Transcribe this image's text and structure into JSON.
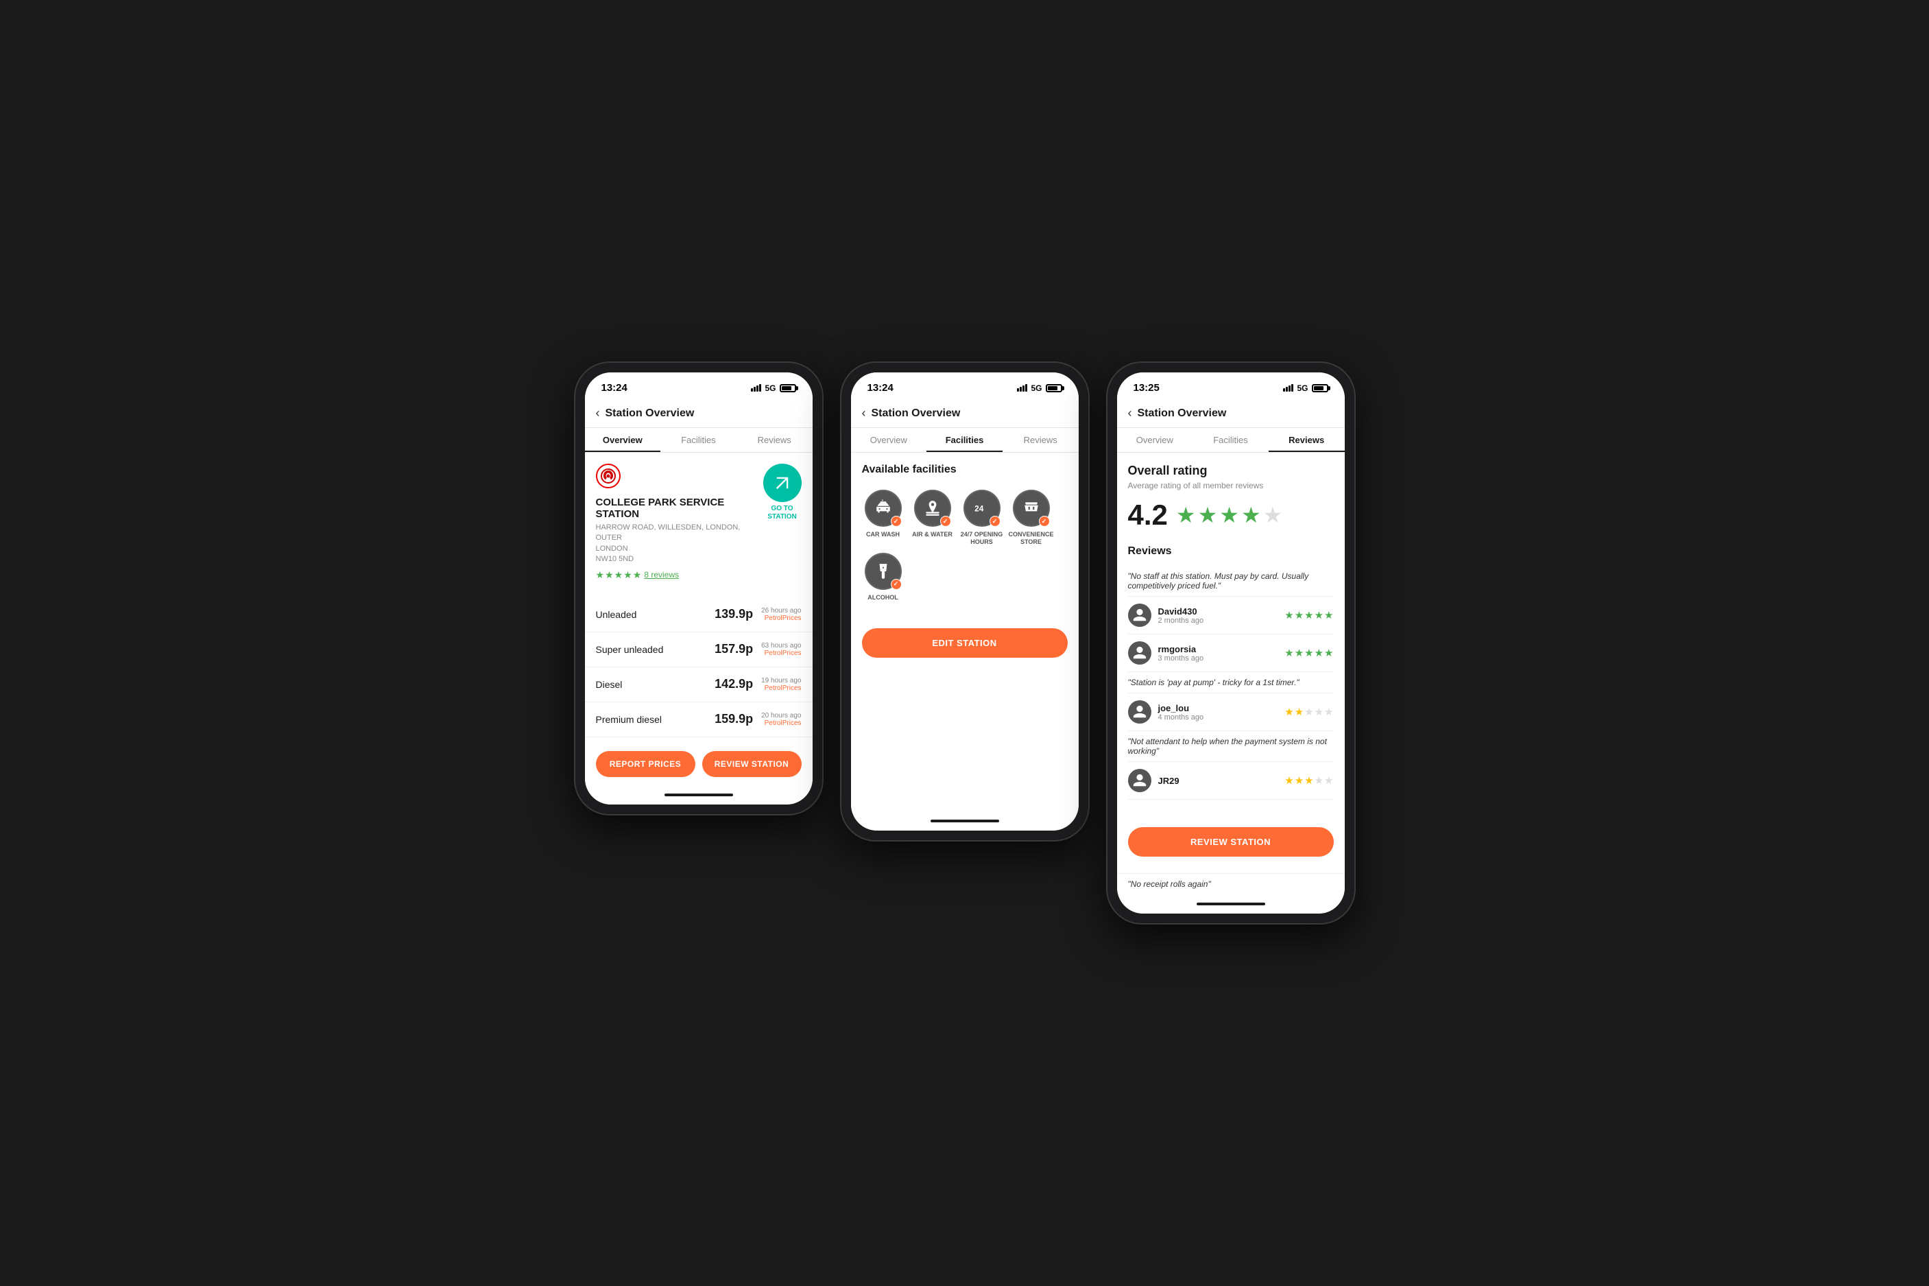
{
  "phones": [
    {
      "id": "phone1",
      "status_time": "13:24",
      "network": "5G",
      "nav_title": "Station Overview",
      "tabs": [
        "Overview",
        "Facilities",
        "Reviews"
      ],
      "active_tab": 0,
      "station": {
        "name": "COLLEGE PARK SERVICE STATION",
        "address_line1": "HARROW ROAD, WILLESDEN, LONDON, OUTER",
        "address_line2": "LONDON",
        "address_line3": "NW10 5ND",
        "rating": "4.5",
        "reviews_count": "8 reviews",
        "go_btn_label": "GO TO\nSTATION"
      },
      "fuels": [
        {
          "name": "Unleaded",
          "price": "139.9p",
          "time": "26 hours ago",
          "source": "PetrolPrices"
        },
        {
          "name": "Super unleaded",
          "price": "157.9p",
          "time": "63 hours ago",
          "source": "PetrolPrices"
        },
        {
          "name": "Diesel",
          "price": "142.9p",
          "time": "19 hours ago",
          "source": "PetrolPrices"
        },
        {
          "name": "Premium diesel",
          "price": "159.9p",
          "time": "20 hours ago",
          "source": "PetrolPrices"
        }
      ],
      "buttons": {
        "report": "REPORT PRICES",
        "review": "REVIEW STATION"
      }
    },
    {
      "id": "phone2",
      "status_time": "13:24",
      "network": "5G",
      "nav_title": "Station Overview",
      "tabs": [
        "Overview",
        "Facilities",
        "Reviews"
      ],
      "active_tab": 1,
      "facilities_title": "Available facilities",
      "facilities": [
        {
          "label": "CAR WASH",
          "icon": "car-wash"
        },
        {
          "label": "AIR & WATER",
          "icon": "air-water"
        },
        {
          "label": "24/7 OPENING HOURS",
          "icon": "24hours"
        },
        {
          "label": "CONVENIENCE STORE",
          "icon": "store"
        },
        {
          "label": "ALCOHOL",
          "icon": "alcohol"
        }
      ],
      "button": "EDIT STATION"
    },
    {
      "id": "phone3",
      "status_time": "13:25",
      "network": "5G",
      "nav_title": "Station Overview",
      "tabs": [
        "Overview",
        "Facilities",
        "Reviews"
      ],
      "active_tab": 2,
      "overall_title": "Overall rating",
      "overall_subtitle": "Average rating of all member reviews",
      "rating_number": "4.2",
      "reviews_title": "Reviews",
      "reviews": [
        {
          "quote": "\"No staff at this station. Must pay by card. Usually competitively priced fuel.\"",
          "user": "David430",
          "time": "2 months ago",
          "stars": 5,
          "star_color": "green"
        },
        {
          "user": "rmgorsia",
          "time": "3 months ago",
          "stars": 5,
          "star_color": "green"
        },
        {
          "quote": "\"Station is 'pay at pump' - tricky for a 1st timer.\"",
          "user": "joe_lou",
          "time": "4 months ago",
          "stars": 2.5,
          "star_color": "yellow"
        },
        {
          "quote": "\"Not attendant to help when the payment system is not working\"",
          "user": "JR29",
          "time": "",
          "stars": 3,
          "star_color": "yellow"
        },
        {
          "quote": "\"No receipt rolls again\""
        }
      ],
      "button": "REVIEW STATION"
    }
  ]
}
